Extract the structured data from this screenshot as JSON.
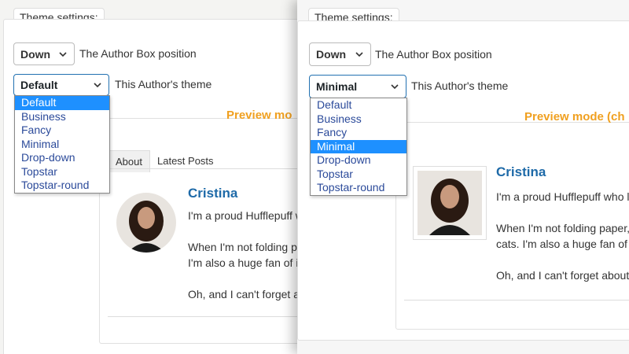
{
  "left": {
    "theme_settings_label": "Theme settings:",
    "position_select_value": "Down",
    "position_label": "The Author Box position",
    "theme_select_value": "Default",
    "theme_label": "This Author's theme",
    "theme_options": [
      "Default",
      "Business",
      "Fancy",
      "Minimal",
      "Drop-down",
      "Topstar",
      "Topstar-round"
    ],
    "preview_text": "Preview mo",
    "tabs": [
      "About",
      "Latest Posts"
    ],
    "author_name": "Cristina",
    "bio_lines": [
      "I'm a proud Hufflepuff w",
      "",
      "When I'm not folding pa",
      "I'm also a huge fan of i",
      "",
      "Oh, and I can't forget a"
    ]
  },
  "right": {
    "theme_settings_label": "Theme settings:",
    "position_select_value": "Down",
    "position_label": "The Author Box position",
    "theme_select_value": "Minimal",
    "theme_label": "This Author's theme",
    "theme_options": [
      "Default",
      "Business",
      "Fancy",
      "Minimal",
      "Drop-down",
      "Topstar",
      "Topstar-round"
    ],
    "preview_text": "Preview mode (ch",
    "author_name": "Cristina",
    "bio_lines": [
      "I'm a proud Hufflepuff who lo",
      "",
      "When I'm not folding paper, I",
      "cats. I'm also a huge fan of i",
      "",
      "Oh, and I can't forget about r"
    ]
  },
  "colors": {
    "accent": "#1e6aa8",
    "preview": "#f0a020",
    "highlight": "#1e90ff",
    "option_text": "#2b4a9a"
  }
}
